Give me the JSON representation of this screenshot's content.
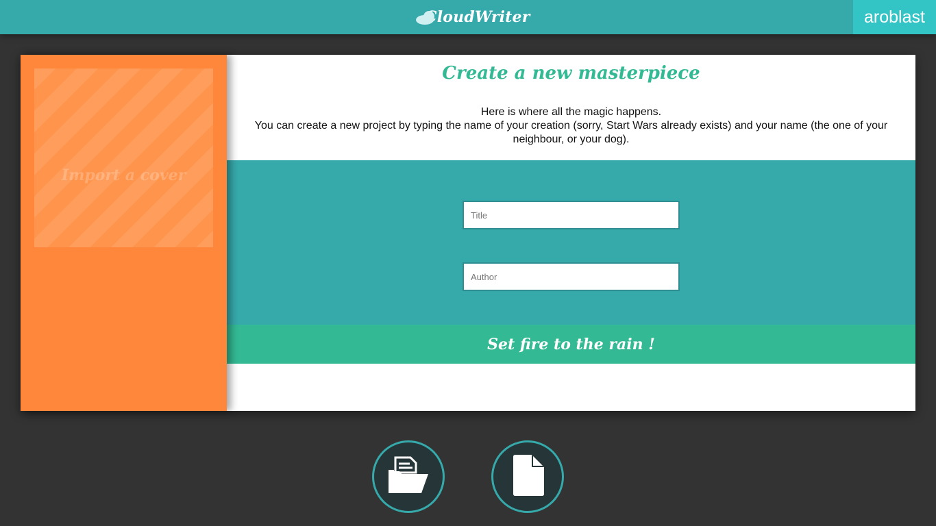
{
  "header": {
    "logo_text": "CloudWriter",
    "username": "aroblast"
  },
  "cover": {
    "label": "Import a cover"
  },
  "main": {
    "title": "Create a new masterpiece",
    "description_line1": "Here is where all the magic happens.",
    "description_line2": "You can create a new project by typing the name of your creation (sorry, Start Wars already exists) and your name (the one of your neighbour, or your dog)."
  },
  "form": {
    "title_placeholder": "Title",
    "title_value": "",
    "author_placeholder": "Author",
    "author_value": "",
    "submit_label": "Set fire to the rain !"
  },
  "actions": [
    {
      "icon": "folder-open-icon"
    },
    {
      "icon": "new-file-icon"
    }
  ],
  "colors": {
    "topbar": "#36a9ab",
    "user_badge": "#33c4c6",
    "cover_panel": "#ff873b",
    "accent_green": "#33b994",
    "form_area": "#36a9ab",
    "background": "#333333"
  }
}
